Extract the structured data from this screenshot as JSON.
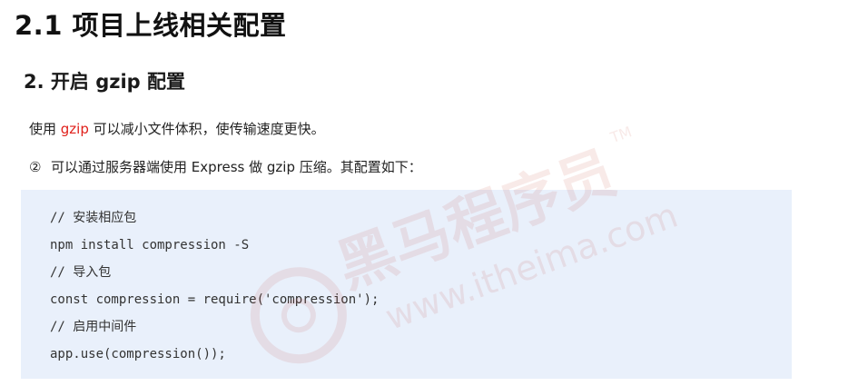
{
  "heading_main": "2.1 项目上线相关配置",
  "heading_sub": "2. 开启 gzip 配置",
  "intro": {
    "prefix": "使用 ",
    "keyword": "gzip",
    "suffix": " 可以减小文件体积，使传输速度更快。"
  },
  "step": {
    "number": "②",
    "text": "可以通过服务器端使用 Express 做 gzip 压缩。其配置如下："
  },
  "code_lines": [
    "// 安装相应包",
    "npm install compression -S",
    "// 导入包",
    "const compression = require('compression');",
    "// 启用中间件",
    "app.use(compression());"
  ],
  "watermark": {
    "brand": "黑马程序员",
    "trademark": "TM",
    "url": "www.itheima.com"
  },
  "colors": {
    "keyword": "#e0201b",
    "code_background": "#e9f0fb",
    "watermark": "#c0392b"
  }
}
